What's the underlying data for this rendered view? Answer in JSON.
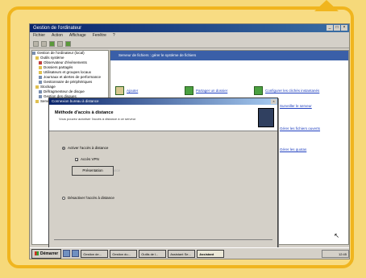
{
  "window": {
    "title": "Gestion de l'ordinateur",
    "controls": [
      "_",
      "□",
      "×"
    ]
  },
  "menubar": [
    "Fichier",
    "Action",
    "Affichage",
    "Fenêtre",
    "?"
  ],
  "tree": {
    "items": [
      {
        "label": "Gestion de l'ordinateur (local)",
        "icon": "computer-icon"
      },
      {
        "label": "Outils système",
        "icon": "folder-icon"
      },
      {
        "label": "Observateur d'événements",
        "icon": "folder-icon"
      },
      {
        "label": "Dossiers partagés",
        "icon": "folder-icon"
      },
      {
        "label": "Utilisateurs et groupes locaux",
        "icon": "folder-icon"
      },
      {
        "label": "Journaux et alertes de performance",
        "icon": "folder-icon"
      },
      {
        "label": "Gestionnaire de périphériques",
        "icon": "device-icon"
      },
      {
        "label": "Stockage",
        "icon": "folder-icon"
      },
      {
        "label": "Défragmenteur de disque",
        "icon": "disk-icon"
      },
      {
        "label": "Gestion des disques",
        "icon": "disk-icon"
      },
      {
        "label": "Services et applications",
        "icon": "folder-icon"
      }
    ]
  },
  "rpane": {
    "header": "Serveur de fichiers : gérer le système de fichiers",
    "tasks": [
      "Ajouter",
      "Partager un dossier",
      "Configurer les clichés instantanés",
      "Surveiller le serveur",
      "Gérer les fichiers ouverts",
      "Gérer les quotas"
    ]
  },
  "dialog": {
    "title": "Connexion bureau à distance",
    "heading": "Méthode d'accès à distance",
    "subheading": "Vous pouvez autoriser l'accès à distance à ce serveur",
    "options": {
      "allow": "Activer l'accès à distance",
      "sub1": "Accès VPN",
      "sub2": "Accès réseau à distance",
      "deny": "Désactiver l'accès à distance"
    },
    "button": "Présentation"
  },
  "taskbar": {
    "start": "Démarrer",
    "buttons": [
      "Gestion de...",
      "Gestion du...",
      "Outils de l...",
      "Assistant Se...",
      "Assistant"
    ],
    "clock": "12:45"
  }
}
